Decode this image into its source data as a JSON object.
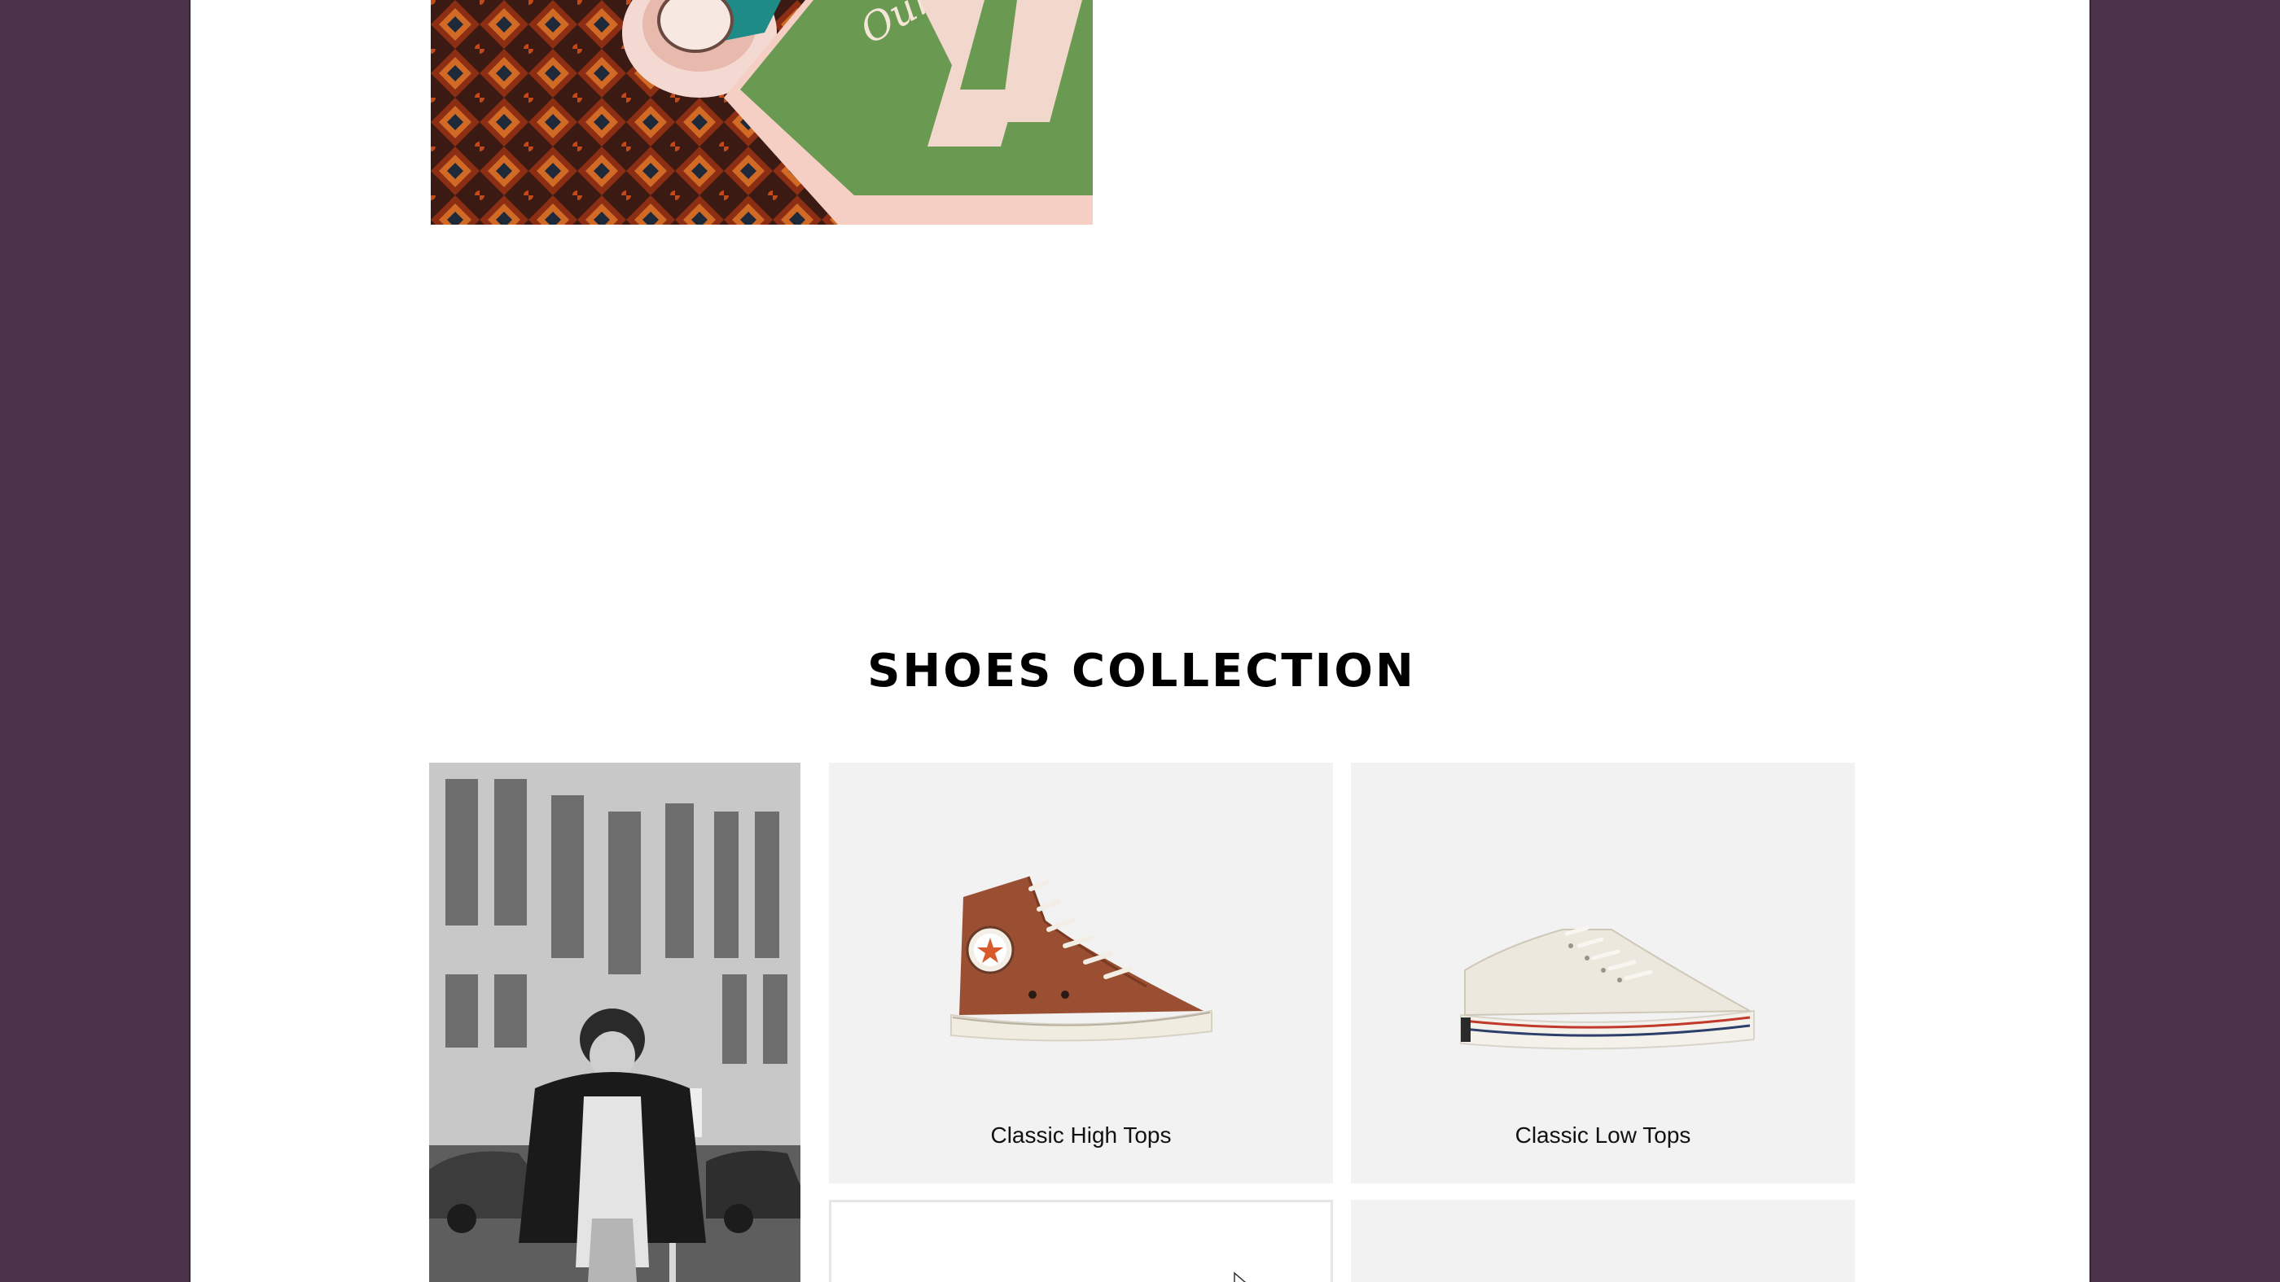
{
  "section": {
    "title": "SHOES COLLECTION"
  },
  "products": [
    {
      "name": "Classic High Tops",
      "color": "#9a4f33"
    },
    {
      "name": "Classic Low Tops",
      "color": "#ece8de"
    }
  ],
  "icons": {
    "cursor": "arrow-cursor-icon"
  },
  "colors": {
    "page_background": "#4a3349",
    "card_background": "#f2f2f2"
  }
}
